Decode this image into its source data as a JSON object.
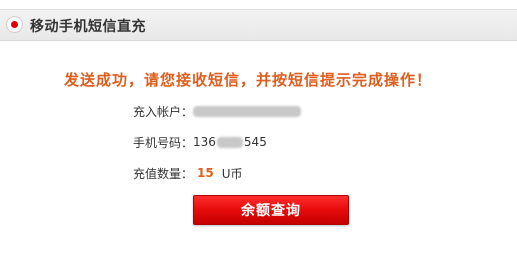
{
  "header": {
    "title": "移动手机短信直充"
  },
  "message": "发送成功，请您接收短信，并按短信提示完成操作！",
  "details": {
    "account_label": "充入帐户：",
    "phone_label": "手机号码：",
    "phone_prefix": "136",
    "phone_suffix": "545",
    "amount_label": "充值数量：",
    "amount_value": "15",
    "amount_unit": "U币"
  },
  "button": {
    "label": "余额查询"
  },
  "colors": {
    "accent": "#e05d1c",
    "button": "#e00000",
    "header_bg": "#efefef"
  }
}
